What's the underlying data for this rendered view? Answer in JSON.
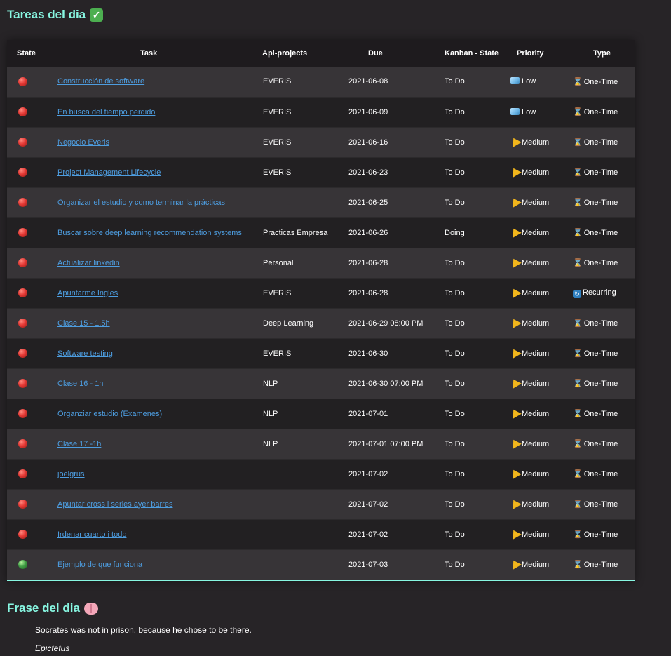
{
  "tasks_heading": "Tareas del dia",
  "columns": [
    "State",
    "Task",
    "Api-projects",
    "Due",
    "Kanban - State",
    "Priority",
    "Type"
  ],
  "rows": [
    {
      "state": "red",
      "task": "Construcción de software",
      "project": "EVERIS",
      "due": "2021-06-08",
      "kanban": "To Do",
      "priority": "Low",
      "type": "One-Time"
    },
    {
      "state": "red",
      "task": "En busca del tiempo perdido",
      "project": "EVERIS",
      "due": "2021-06-09",
      "kanban": "To Do",
      "priority": "Low",
      "type": "One-Time"
    },
    {
      "state": "red",
      "task": "Negocio Everis",
      "project": "EVERIS",
      "due": "2021-06-16",
      "kanban": "To Do",
      "priority": "Medium",
      "type": "One-Time"
    },
    {
      "state": "red",
      "task": "Project Management Lifecycle",
      "project": "EVERIS",
      "due": "2021-06-23",
      "kanban": "To Do",
      "priority": "Medium",
      "type": "One-Time"
    },
    {
      "state": "red",
      "task": "Organizar el estudio y como terminar la prácticas",
      "project": "",
      "due": "2021-06-25",
      "kanban": "To Do",
      "priority": "Medium",
      "type": "One-Time"
    },
    {
      "state": "red",
      "task": "Buscar sobre deep learning recommendation systems",
      "project": "Practicas Empresa",
      "due": "2021-06-26",
      "kanban": "Doing",
      "priority": "Medium",
      "type": "One-Time"
    },
    {
      "state": "red",
      "task": "Actualizar linkedin",
      "project": "Personal",
      "due": "2021-06-28",
      "kanban": "To Do",
      "priority": "Medium",
      "type": "One-Time"
    },
    {
      "state": "red",
      "task": "Apuntarme Ingles",
      "project": "EVERIS",
      "due": "2021-06-28",
      "kanban": "To Do",
      "priority": "Medium",
      "type": "Recurring"
    },
    {
      "state": "red",
      "task": "Clase 15 - 1.5h",
      "project": "Deep Learning",
      "due": "2021-06-29 08:00 PM",
      "kanban": "To Do",
      "priority": "Medium",
      "type": "One-Time"
    },
    {
      "state": "red",
      "task": "Software testing",
      "project": "EVERIS",
      "due": "2021-06-30",
      "kanban": "To Do",
      "priority": "Medium",
      "type": "One-Time"
    },
    {
      "state": "red",
      "task": "Clase 16 - 1h",
      "project": "NLP",
      "due": "2021-06-30 07:00 PM",
      "kanban": "To Do",
      "priority": "Medium",
      "type": "One-Time"
    },
    {
      "state": "red",
      "task": "Organziar estudio (Examenes)",
      "project": "NLP",
      "due": "2021-07-01",
      "kanban": "To Do",
      "priority": "Medium",
      "type": "One-Time"
    },
    {
      "state": "red",
      "task": "Clase 17 -1h",
      "project": "NLP",
      "due": "2021-07-01 07:00 PM",
      "kanban": "To Do",
      "priority": "Medium",
      "type": "One-Time"
    },
    {
      "state": "red",
      "task": "joelgrus",
      "project": "",
      "due": "2021-07-02",
      "kanban": "To Do",
      "priority": "Medium",
      "type": "One-Time"
    },
    {
      "state": "red",
      "task": "Apuntar cross i series ayer barres",
      "project": "",
      "due": "2021-07-02",
      "kanban": "To Do",
      "priority": "Medium",
      "type": "One-Time"
    },
    {
      "state": "red",
      "task": "Irdenar cuarto i todo",
      "project": "",
      "due": "2021-07-02",
      "kanban": "To Do",
      "priority": "Medium",
      "type": "One-Time"
    },
    {
      "state": "green",
      "task": "Ejemplo de que funciona",
      "project": "",
      "due": "2021-07-03",
      "kanban": "To Do",
      "priority": "Medium",
      "type": "One-Time"
    }
  ],
  "icons": {
    "state_red": "red-circle-icon",
    "state_green": "green-circle-icon",
    "priority_low": "ice-cube-icon",
    "priority_medium": "cheese-icon",
    "type_one_time": "hourglass-icon",
    "type_recurring": "recycle-icon",
    "heading_tasks": "check-mark-icon",
    "heading_quote": "brain-icon"
  },
  "colors": {
    "heading": "#88f7e2",
    "link": "#4d9de0",
    "background": "#272427"
  },
  "quote_heading": "Frase del dia",
  "quote": "Socrates was not in prison, because he chose to be there.",
  "author": "Epictetus"
}
